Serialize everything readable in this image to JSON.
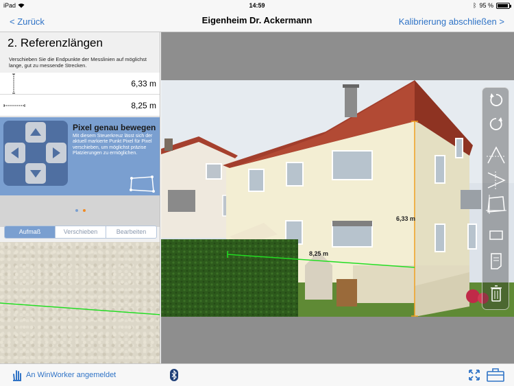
{
  "status": {
    "device": "iPad",
    "time": "14:59",
    "battery": "95 %",
    "battery_level": 0.95
  },
  "nav": {
    "back_label": "< Zurück",
    "title": "Eigenheim Dr. Ackermann",
    "action_label": "Kalibrierung abschließen >"
  },
  "panel": {
    "title": "2. Referenzlängen",
    "description": "Verschieben Sie die Endpunkte der Messlinien auf möglichst lange, gut zu messende Strecken.",
    "references": [
      {
        "value": "6,33 m",
        "orientation": "vertical"
      },
      {
        "value": "8,25 m",
        "orientation": "horizontal"
      }
    ],
    "dpad": {
      "title": "Pixel genau bewegen",
      "description": "Mit diesem Steuerkreuz lässt sich der aktuell markierte Punkt Pixel für Pixel verschieben, um möglichst präzise Platzierungen zu ermöglichen."
    },
    "pager": {
      "pages": 2,
      "current": 2
    },
    "segments": [
      "Aufmaß",
      "Verschieben",
      "Bearbeiten"
    ],
    "selected_segment": "Aufmaß"
  },
  "measurements": [
    {
      "label": "6,33 m",
      "color": "#f0a020"
    },
    {
      "label": "8,25 m",
      "color": "#22dd22"
    }
  ],
  "toolbar": [
    "rotate-ccw-icon",
    "rotate-cw-icon",
    "perspective-vertical-icon",
    "perspective-horizontal-icon",
    "crop-perspective-icon",
    "rectangle-icon",
    "note-icon",
    "trash-icon"
  ],
  "bottom": {
    "login_label": "An WinWorker angemeldet"
  },
  "colors": {
    "accent": "#2f73c6",
    "panel_blue": "#7a9fd0",
    "measure_vertical": "#f0a020",
    "measure_horizontal": "#22dd22"
  }
}
